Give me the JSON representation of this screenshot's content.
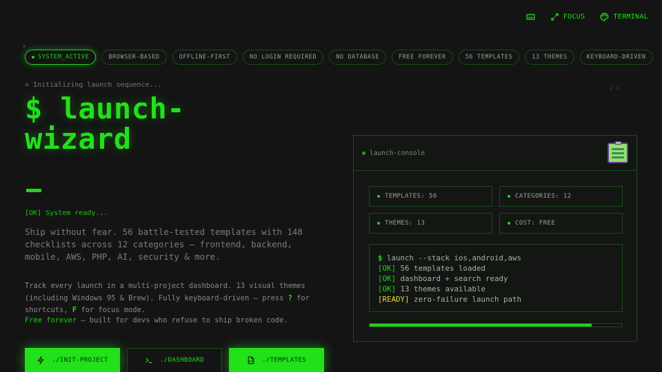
{
  "topnav": {
    "focus_label": "FOCUS",
    "terminal_label": "TERMINAL"
  },
  "tags": [
    "SYSTEM_ACTIVE",
    "BROWSER-BASED",
    "OFFLINE-FIRST",
    "NO LOGIN REQUIRED",
    "NO DATABASE",
    "FREE FOREVER",
    "56 TEMPLATES",
    "13 THEMES",
    "KEYBOARD-DRIVEN"
  ],
  "hero": {
    "init_line": "> Initializing launch sequence...",
    "title": "$ launch-wizard",
    "ok_line": "[OK] System ready...",
    "description": "Ship without fear. 56 battle-tested templates with 148 checklists across 12 categories — frontend, backend, mobile, AWS, PHP, AI, security & more.",
    "track_1": "Track every launch in a multi-project dashboard. 13 visual themes (including Windows 95 & Brew). Fully keyboard-driven — press ",
    "key_q": "?",
    "track_2": " for shortcuts, ",
    "key_f": "F",
    "track_3": " for focus mode.",
    "free_hl": "Free forever",
    "free_rest": " — built for devs who refuse to ship broken code."
  },
  "buttons": {
    "init": "./INIT-PROJECT",
    "dashboard": "./DASHBOARD",
    "templates": "./TEMPLATES"
  },
  "console": {
    "title": "launch-console",
    "stats": [
      "TEMPLATES: 56",
      "CATEGORIES: 12",
      "THEMES: 13",
      "COST: FREE"
    ],
    "terminal": {
      "prompt": "$",
      "command": " launch --stack ios,android,aws",
      "lines": [
        {
          "tag": "[OK]",
          "text": " 56 templates loaded"
        },
        {
          "tag": "[OK]",
          "text": " dashboard + search ready"
        },
        {
          "tag": "[OK]",
          "text": " 13 themes available"
        }
      ],
      "ready_tag": "[READY]",
      "ready_text": " zero-failure launch path"
    },
    "progress": 0.88
  },
  "colors": {
    "accent": "#22e01a",
    "background": "#141414",
    "ready": "#e3d93a"
  }
}
